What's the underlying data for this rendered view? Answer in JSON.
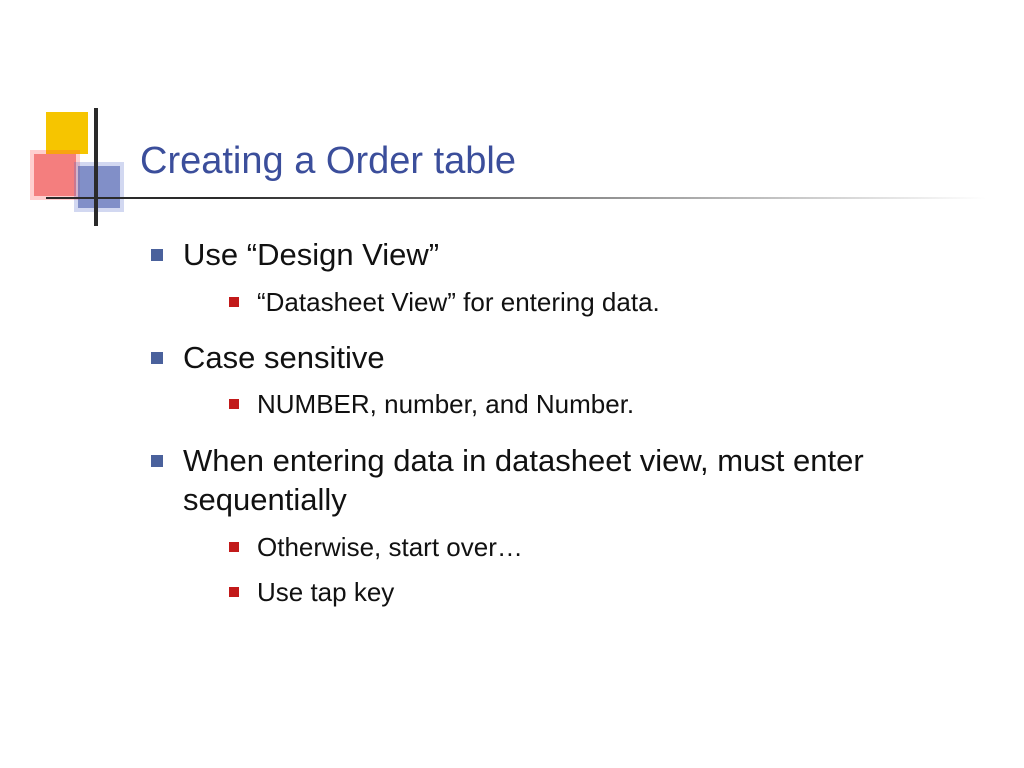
{
  "title": "Creating a Order table",
  "bullets": [
    {
      "text": "Use “Design View”",
      "sub": [
        "“Datasheet View” for entering data."
      ]
    },
    {
      "text": "Case sensitive",
      "sub": [
        "NUMBER, number, and Number."
      ]
    },
    {
      "text": "When entering data in datasheet view, must enter sequentially",
      "sub": [
        "Otherwise, start over…",
        "Use tap key"
      ]
    }
  ]
}
